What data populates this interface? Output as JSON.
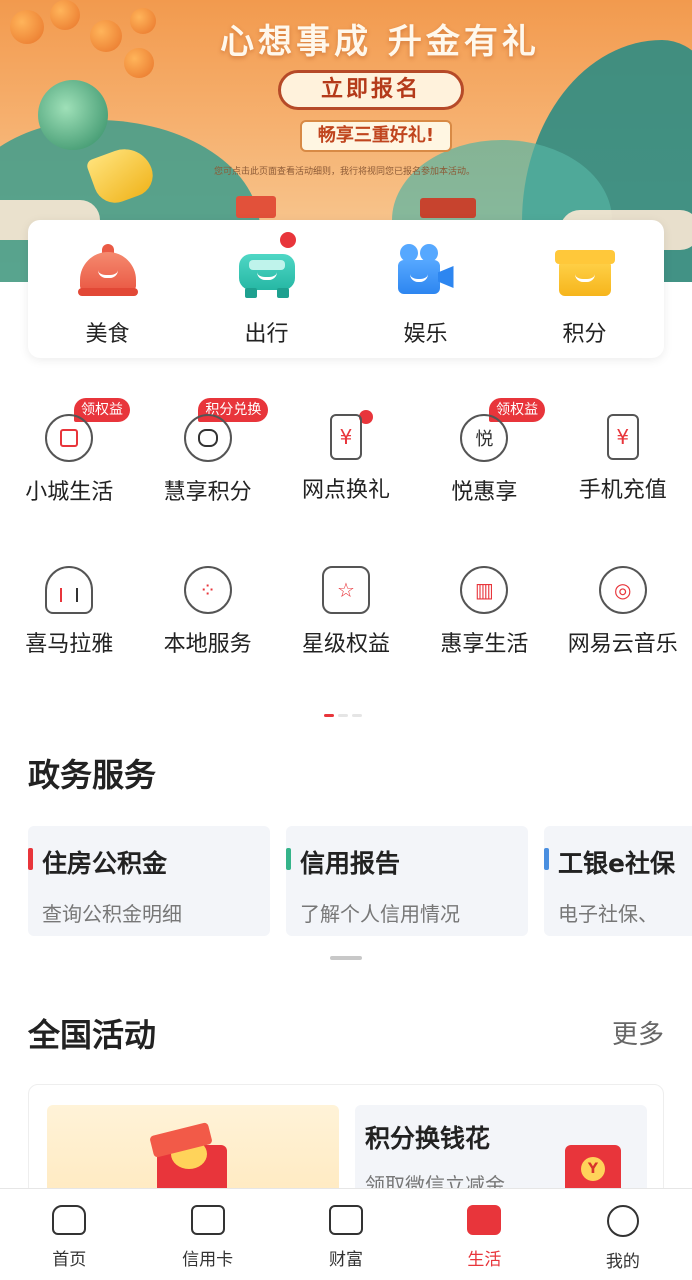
{
  "banner": {
    "title": "心想事成 升金有礼",
    "signup_label": "立即报名",
    "gift_text": "畅享三重好礼!",
    "note": "您可点击此页面查看活动细则，我行将视同您已报名参加本活动。"
  },
  "categories": [
    {
      "label": "美食",
      "icon": "dome-food-icon",
      "dot": false
    },
    {
      "label": "出行",
      "icon": "car-icon",
      "dot": true
    },
    {
      "label": "娱乐",
      "icon": "video-camera-icon",
      "dot": false
    },
    {
      "label": "积分",
      "icon": "gift-box-icon",
      "dot": false
    }
  ],
  "services_row1": [
    {
      "label": "小城生活",
      "icon": "shopping-bag-icon",
      "badge": "领权益"
    },
    {
      "label": "慧享积分",
      "icon": "coin-stack-icon",
      "badge": "积分兑换"
    },
    {
      "label": "网点换礼",
      "icon": "gift-card-icon",
      "dot": true,
      "glyph": "¥"
    },
    {
      "label": "悦惠享",
      "icon": "yue-icon",
      "badge": "领权益",
      "glyph": "悦"
    },
    {
      "label": "手机充值",
      "icon": "phone-icon",
      "glyph": "¥"
    }
  ],
  "services_row2": [
    {
      "label": "喜马拉雅",
      "icon": "headphones-icon"
    },
    {
      "label": "本地服务",
      "icon": "grid-icon",
      "glyph": "⁘"
    },
    {
      "label": "星级权益",
      "icon": "star-medal-icon",
      "glyph": "☆"
    },
    {
      "label": "惠享生活",
      "icon": "building-icon",
      "glyph": "▥"
    },
    {
      "label": "网易云音乐",
      "icon": "music-icon",
      "glyph": "◎"
    }
  ],
  "gov": {
    "title": "政务服务",
    "cards": [
      {
        "title": "住房公积金",
        "subtitle": "查询公积金明细",
        "accent": "#e8353b"
      },
      {
        "title": "信用报告",
        "subtitle": "了解个人信用情况",
        "accent": "#35b48a"
      },
      {
        "title": "工银e社保",
        "subtitle": "电子社保、",
        "accent": "#4a8fe0"
      }
    ]
  },
  "activities": {
    "title": "全国活动",
    "more_label": "更多",
    "right_card": {
      "title": "积分换钱花",
      "subtitle": "领取微信立减金"
    },
    "coin_glyph": "Y"
  },
  "nav": [
    {
      "label": "首页",
      "icon": "home-icon",
      "active": false
    },
    {
      "label": "信用卡",
      "icon": "credit-card-icon",
      "active": false
    },
    {
      "label": "财富",
      "icon": "chart-icon",
      "active": false
    },
    {
      "label": "生活",
      "icon": "ticket-icon",
      "active": true
    },
    {
      "label": "我的",
      "icon": "profile-icon",
      "active": false
    }
  ],
  "colors": {
    "accent": "#e8353b"
  }
}
